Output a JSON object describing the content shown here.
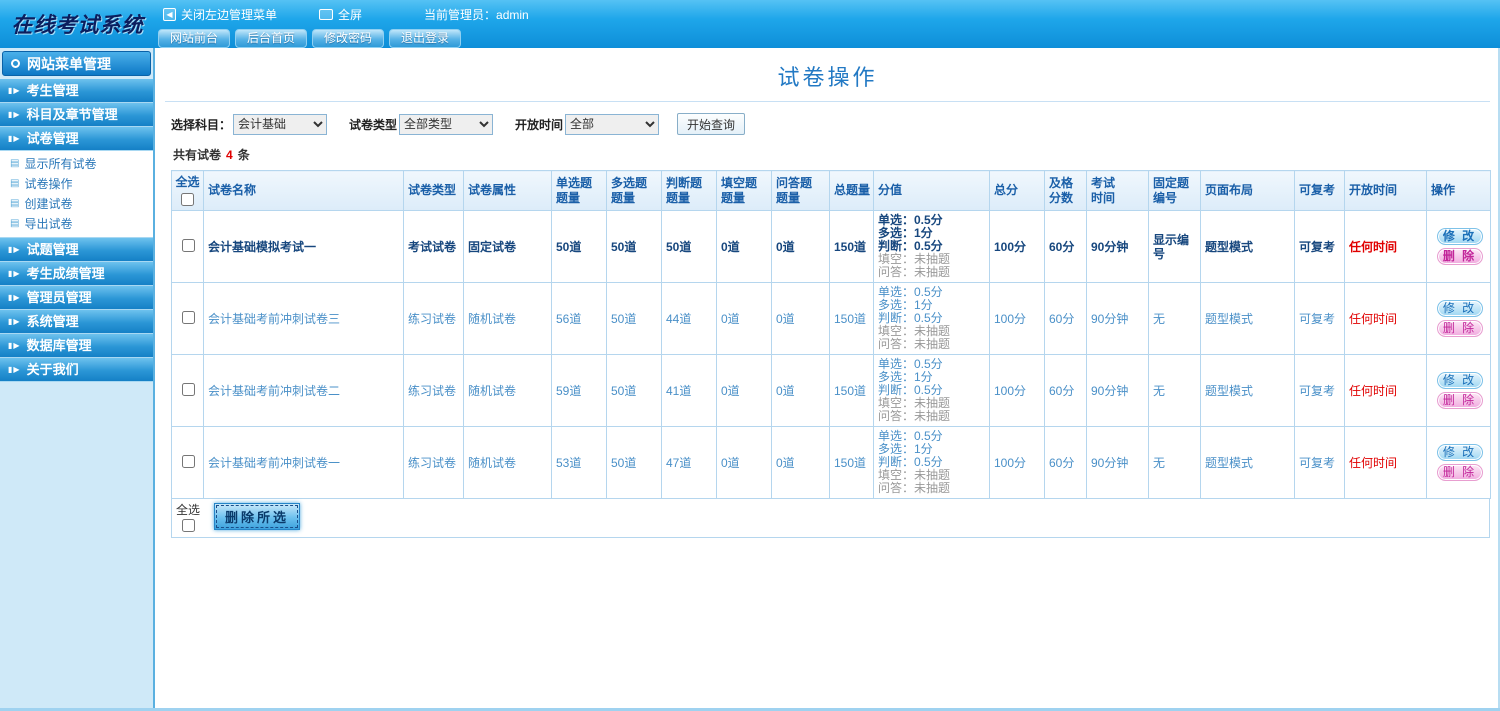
{
  "colors": {
    "accent": "#2279c4",
    "danger": "#e00000",
    "pink": "#c2259a"
  },
  "header": {
    "logo": "在线考试系统",
    "close_menu": "关闭左边管理菜单",
    "fullscreen": "全屏",
    "admin_label": "当前管理员：admin"
  },
  "tabs": [
    "网站前台",
    "后台首页",
    "修改密码",
    "退出登录"
  ],
  "sidebar": {
    "title": "网站菜单管理",
    "items": [
      {
        "label": "考生管理"
      },
      {
        "label": "科目及章节管理"
      },
      {
        "label": "试卷管理",
        "children": [
          "显示所有试卷",
          "试卷操作",
          "创建试卷",
          "导出试卷"
        ]
      },
      {
        "label": "试题管理"
      },
      {
        "label": "考生成绩管理"
      },
      {
        "label": "管理员管理"
      },
      {
        "label": "系统管理"
      },
      {
        "label": "数据库管理"
      },
      {
        "label": "关于我们"
      }
    ]
  },
  "main": {
    "title": "试卷操作",
    "filters": {
      "subject_label": "选择科目：",
      "subject_value": "会计基础",
      "type_label": "试卷类型",
      "type_value": "全部类型",
      "time_label": "开放时间",
      "time_value": "全部",
      "search_button": "开始查询"
    },
    "summary": {
      "prefix": "共有试卷",
      "count": "4",
      "suffix": "条"
    },
    "table": {
      "headers": [
        "全选",
        "试卷名称",
        "试卷类型",
        "试卷属性",
        "单选题\n题量",
        "多选题\n题量",
        "判断题\n题量",
        "填空题\n题量",
        "问答题\n题量",
        "总题量",
        "分值",
        "总分",
        "及格\n分数",
        "考试\n时间",
        "固定题\n编号",
        "页面布局",
        "可复考",
        "开放时间",
        "操作"
      ],
      "ops": [
        "修 改",
        "删 除"
      ],
      "rows": [
        {
          "name": "会计基础模拟考试一",
          "type": "考试试卷",
          "attr": "固定试卷",
          "single": "50道",
          "multi": "50道",
          "judge": "50道",
          "fill": "0道",
          "qa": "0道",
          "total": "150道",
          "scores": [
            "单选：0.5分",
            "多选：1分",
            "判断：0.5分",
            "填空：未抽题",
            "问答：未抽题"
          ],
          "total_score": "100分",
          "pass_score": "60分",
          "duration": "90分钟",
          "fixed_no": "显示编号",
          "layout": "题型模式",
          "retake": "可复考",
          "open_time": "任何时间",
          "bold": true
        },
        {
          "name": "会计基础考前冲刺试卷三",
          "type": "练习试卷",
          "attr": "随机试卷",
          "single": "56道",
          "multi": "50道",
          "judge": "44道",
          "fill": "0道",
          "qa": "0道",
          "total": "150道",
          "scores": [
            "单选：0.5分",
            "多选：1分",
            "判断：0.5分",
            "填空：未抽题",
            "问答：未抽题"
          ],
          "total_score": "100分",
          "pass_score": "60分",
          "duration": "90分钟",
          "fixed_no": "无",
          "layout": "题型模式",
          "retake": "可复考",
          "open_time": "任何时间",
          "bold": false
        },
        {
          "name": "会计基础考前冲刺试卷二",
          "type": "练习试卷",
          "attr": "随机试卷",
          "single": "59道",
          "multi": "50道",
          "judge": "41道",
          "fill": "0道",
          "qa": "0道",
          "total": "150道",
          "scores": [
            "单选：0.5分",
            "多选：1分",
            "判断：0.5分",
            "填空：未抽题",
            "问答：未抽题"
          ],
          "total_score": "100分",
          "pass_score": "60分",
          "duration": "90分钟",
          "fixed_no": "无",
          "layout": "题型模式",
          "retake": "可复考",
          "open_time": "任何时间",
          "bold": false
        },
        {
          "name": "会计基础考前冲刺试卷一",
          "type": "练习试卷",
          "attr": "随机试卷",
          "single": "53道",
          "multi": "50道",
          "judge": "47道",
          "fill": "0道",
          "qa": "0道",
          "total": "150道",
          "scores": [
            "单选：0.5分",
            "多选：1分",
            "判断：0.5分",
            "填空：未抽题",
            "问答：未抽题"
          ],
          "total_score": "100分",
          "pass_score": "60分",
          "duration": "90分钟",
          "fixed_no": "无",
          "layout": "题型模式",
          "retake": "可复考",
          "open_time": "任何时间",
          "bold": false
        }
      ]
    },
    "footer": {
      "select_all": "全选",
      "delete_button": "删除所选"
    }
  }
}
